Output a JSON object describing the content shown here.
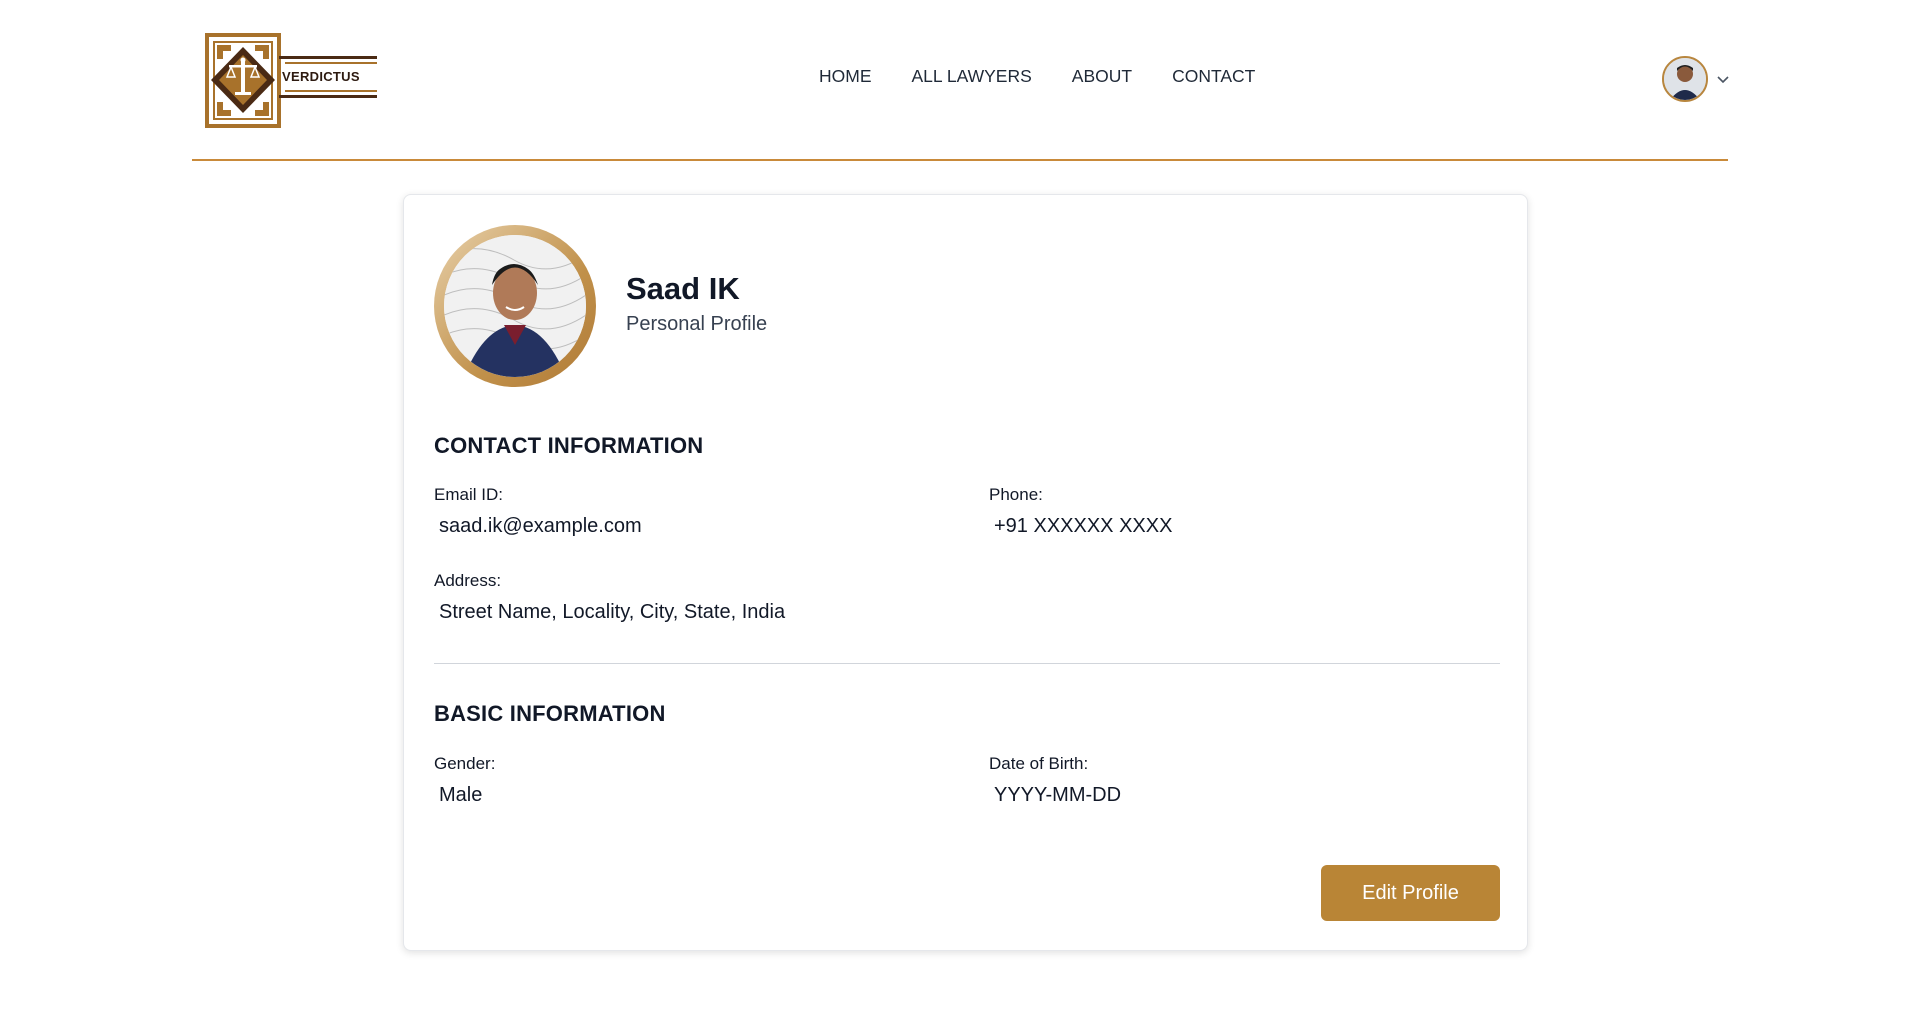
{
  "brand": {
    "name": "VERDICTUS"
  },
  "nav": {
    "items": [
      "HOME",
      "ALL LAWYERS",
      "ABOUT",
      "CONTACT"
    ]
  },
  "user_menu": {
    "avatar_icon": "user-avatar",
    "chevron_icon": "chevron-down-icon"
  },
  "profile": {
    "name": "Saad IK",
    "subtitle": "Personal Profile"
  },
  "contact": {
    "title": "CONTACT INFORMATION",
    "email_label": "Email ID:",
    "email_value": "saad.ik@example.com",
    "phone_label": "Phone:",
    "phone_value": "+91 XXXXXX XXXX",
    "address_label": "Address:",
    "address_value": "Street Name, Locality, City, State, India"
  },
  "basic": {
    "title": "BASIC INFORMATION",
    "gender_label": "Gender:",
    "gender_value": "Male",
    "dob_label": "Date of Birth:",
    "dob_value": "YYYY-MM-DD"
  },
  "actions": {
    "edit_label": "Edit Profile"
  },
  "colors": {
    "accent": "#b98536",
    "header_rule": "#c98a3a",
    "logo_dark": "#4a2a14",
    "logo_gold": "#a8722b"
  }
}
